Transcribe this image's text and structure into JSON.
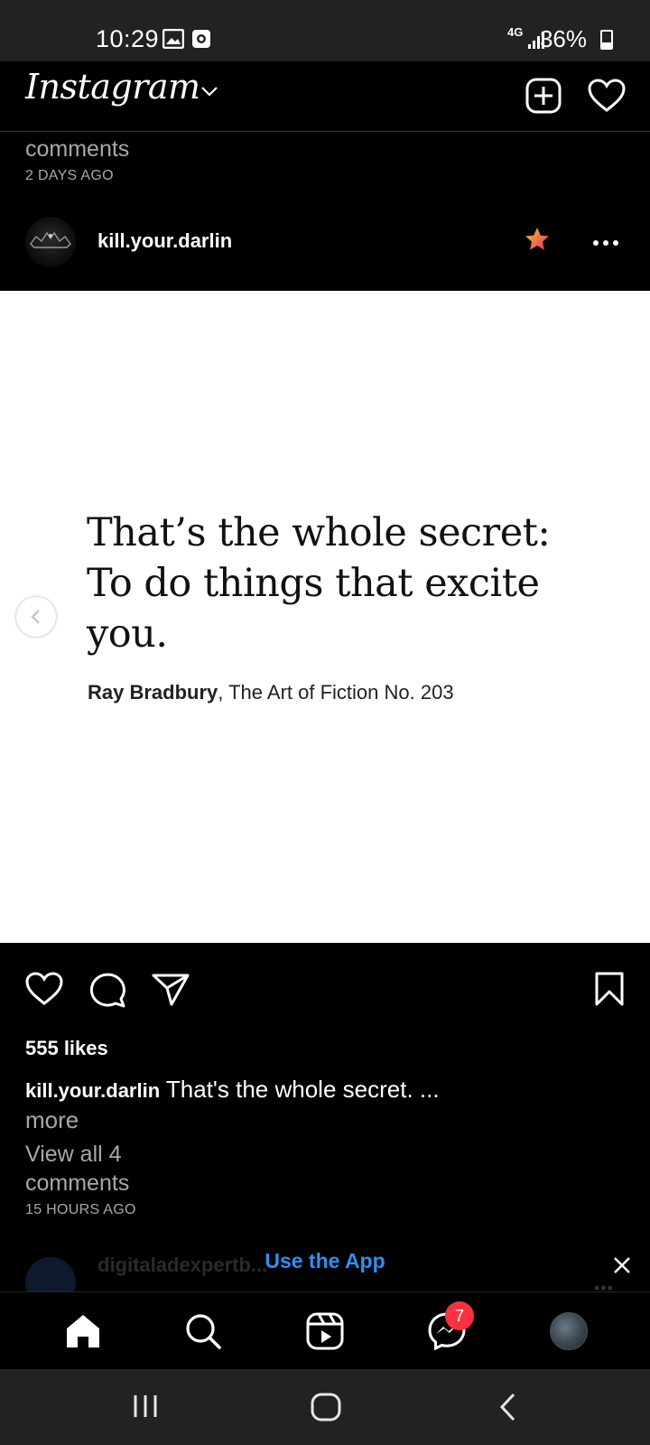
{
  "status_bar": {
    "time": "10:29",
    "network": "4G",
    "battery": "36%",
    "battery_level": 0.36
  },
  "header": {
    "logo": "Instagram"
  },
  "previous_post": {
    "comments_tail": "comments",
    "timestamp": "2 DAYS AGO"
  },
  "post": {
    "username": "kill.your.darlin",
    "image": {
      "quote": "That’s the whole secret: To do things that excite you.",
      "author": "Ray Bradbury",
      "source": ", The Art of Fiction No. 203"
    },
    "likes": "555 likes",
    "caption_user": "kill.your.darlin",
    "caption_text": " That's the whole secret. ...",
    "caption_more": "more",
    "view_comments": "View all 4 comments",
    "timestamp": "15 HOURS AGO"
  },
  "next_post": {
    "username": "digitaladexpertb...",
    "more": "•••"
  },
  "banner": {
    "label": "Use the App"
  },
  "bottom_nav": {
    "messenger_badge": "7"
  },
  "colors": {
    "link_blue": "#2f8ff0",
    "badge_red": "#ff3040",
    "secondary_text": "#a8a8a8"
  }
}
